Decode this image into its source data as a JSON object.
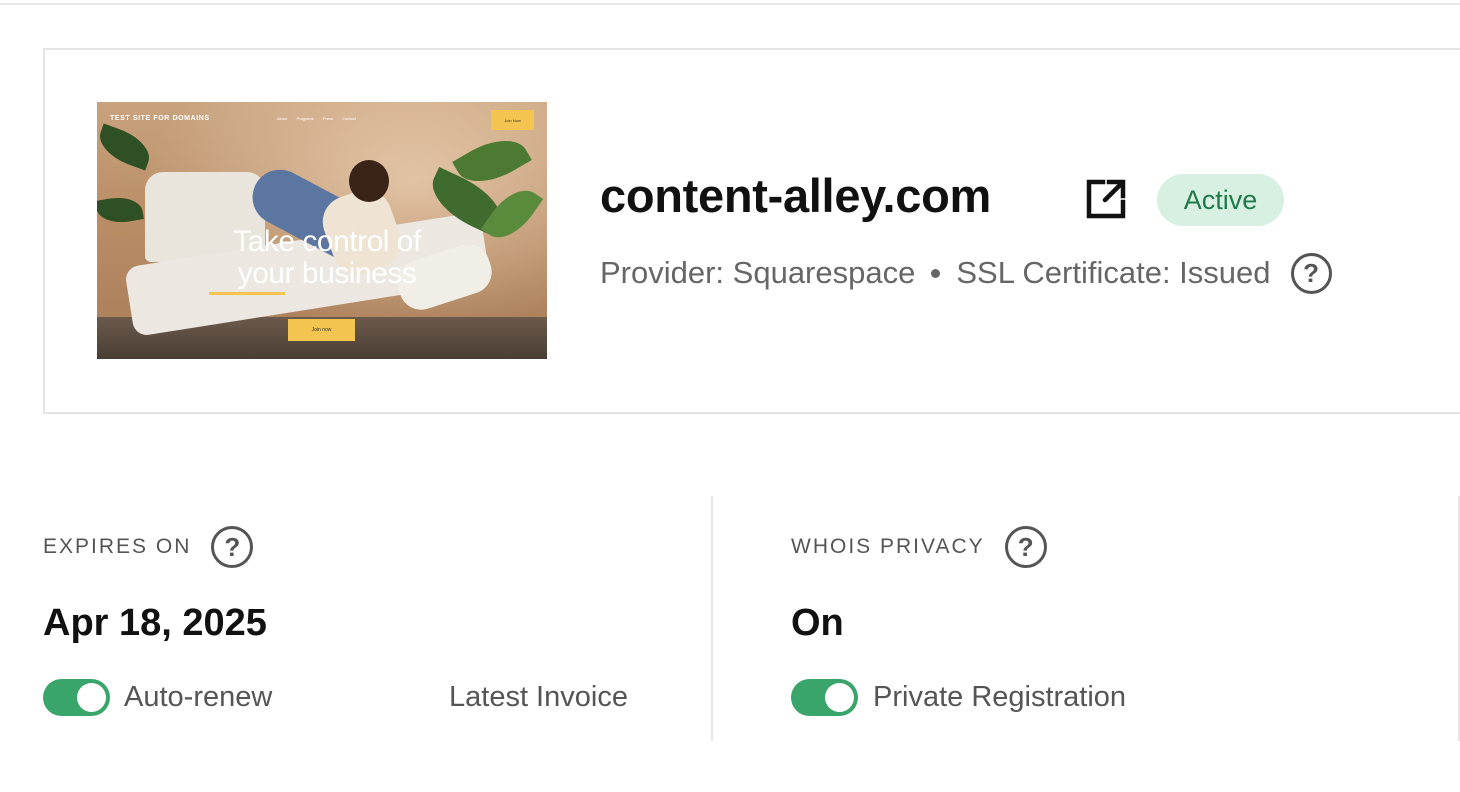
{
  "domain": {
    "name": "content-alley.com",
    "status": "Active",
    "provider_text": "Provider: Squarespace",
    "ssl_text": "SSL Certificate: Issued",
    "help_glyph": "?"
  },
  "thumbnail": {
    "site_name": "TEST SITE FOR DOMAINS",
    "nav": [
      "About",
      "Programs",
      "Press",
      "Contact"
    ],
    "join_top": "Join Now",
    "hero_line1": "Take control of",
    "hero_line2": "your business",
    "join_bottom": "Join now"
  },
  "expires": {
    "label": "EXPIRES ON",
    "value": "Apr 18, 2025",
    "toggle_label": "Auto-renew",
    "toggle_on": true,
    "invoice_link": "Latest Invoice"
  },
  "whois": {
    "label": "WHOIS PRIVACY",
    "value": "On",
    "toggle_label": "Private Registration",
    "toggle_on": true
  },
  "colors": {
    "accent_green": "#3aa56a",
    "badge_bg": "#d8f0e2",
    "badge_text": "#1f7a4a",
    "muted_text": "#666666"
  },
  "icons": {
    "external_link": "external-link-icon",
    "help": "question-circle-icon"
  }
}
